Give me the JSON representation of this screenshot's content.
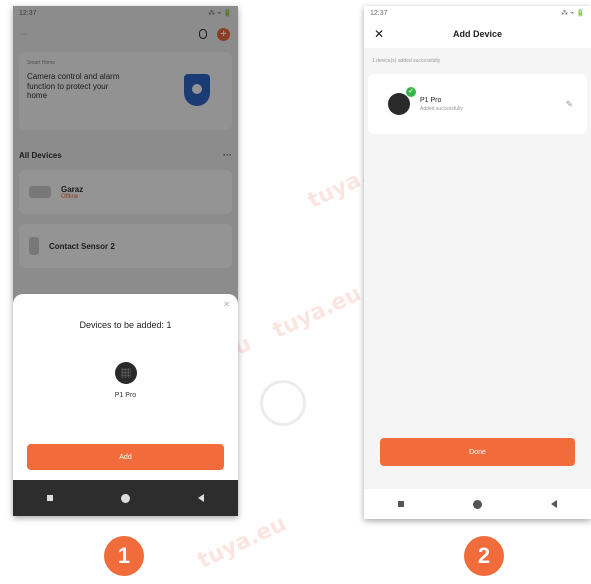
{
  "colors": {
    "accent": "#f26b3a",
    "success": "#39b54a"
  },
  "phone1": {
    "statusbar": {
      "time": "12:37",
      "right": "⁂ ⌁ 🔋"
    },
    "topbar": {
      "left": "···"
    },
    "banner": {
      "tag": "Smart Home",
      "text": "Camera control and alarm function to protect your home"
    },
    "section_title": "All Devices",
    "more_label": "···",
    "devices": [
      {
        "name": "Garaz",
        "status": "Offline"
      },
      {
        "name": "Contact Sensor 2",
        "status": ""
      }
    ],
    "sheet": {
      "close_label": "✕",
      "title": "Devices to be added: 1",
      "device_name": "P1 Pro",
      "add_button": "Add"
    }
  },
  "phone2": {
    "statusbar": {
      "time": "12:37",
      "right": "⁂ ⌁ 🔋"
    },
    "header": {
      "close_icon": "✕",
      "title": "Add Device"
    },
    "subtitle": "1 device(s) added successfully",
    "device": {
      "name": "P1 Pro",
      "status": "Added successfully"
    },
    "done_button": "Done"
  },
  "steps": [
    "1",
    "2"
  ],
  "watermark": "tuya.eu"
}
